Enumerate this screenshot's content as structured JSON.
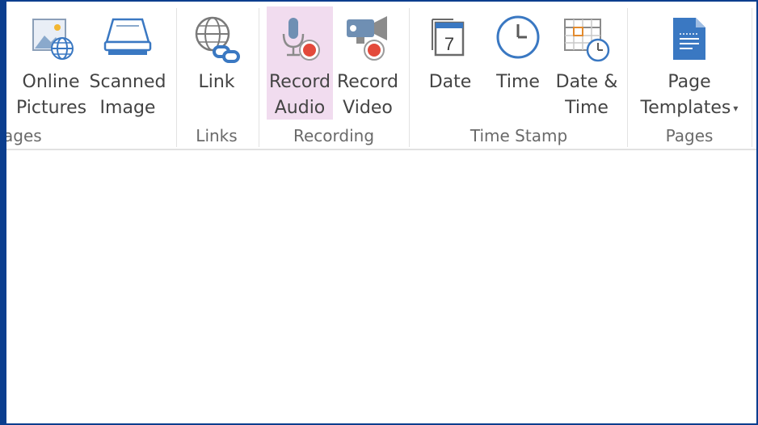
{
  "ribbon": {
    "groups": [
      {
        "label": "ages",
        "buttons": [
          {
            "line1": "Online",
            "line2": "Pictures",
            "icon": "online-pictures-icon"
          },
          {
            "line1": "Scanned",
            "line2": "Image",
            "icon": "scanner-icon"
          }
        ]
      },
      {
        "label": "Links",
        "buttons": [
          {
            "line1": "Link",
            "line2": "",
            "icon": "link-globe-icon"
          }
        ]
      },
      {
        "label": "Recording",
        "buttons": [
          {
            "line1": "Record",
            "line2": "Audio",
            "icon": "microphone-record-icon",
            "active": true
          },
          {
            "line1": "Record",
            "line2": "Video",
            "icon": "video-camera-record-icon"
          }
        ]
      },
      {
        "label": "Time Stamp",
        "buttons": [
          {
            "line1": "Date",
            "line2": "",
            "icon": "calendar-icon",
            "calendar_day": "7"
          },
          {
            "line1": "Time",
            "line2": "",
            "icon": "clock-icon"
          },
          {
            "line1": "Date &",
            "line2": "Time",
            "icon": "calendar-clock-icon"
          }
        ]
      },
      {
        "label": "Pages",
        "buttons": [
          {
            "line1": "Page",
            "line2": "Templates",
            "icon": "page-template-icon",
            "has_dropdown": true
          }
        ]
      }
    ]
  },
  "colors": {
    "window_frame": "#0b3e8e",
    "active_button": "#f1dcef",
    "icon_blue": "#3a78c2",
    "record_red": "#e34a3b",
    "label_text": "#444444",
    "group_label_text": "#6a6a6a"
  },
  "arrow_glyph": "▾"
}
